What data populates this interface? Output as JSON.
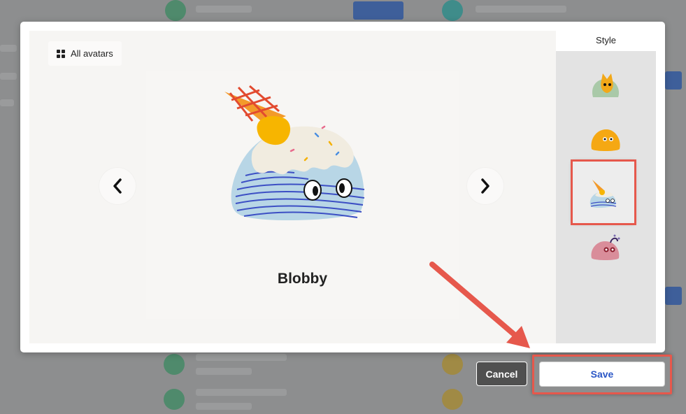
{
  "modal": {
    "all_avatars_label": "All avatars",
    "current_avatar": "Blobby",
    "style_title": "Style",
    "styles": [
      {
        "icon": "cat-blob-avatar-icon",
        "selected": false
      },
      {
        "icon": "yellow-blob-avatar-icon",
        "selected": false
      },
      {
        "icon": "icecream-blob-avatar-icon",
        "selected": true
      },
      {
        "icon": "pink-blob-avatar-icon",
        "selected": false
      }
    ]
  },
  "footer": {
    "cancel_label": "Cancel",
    "save_label": "Save"
  },
  "colors": {
    "highlight": "#e6584c",
    "save_text": "#2a56c6",
    "cancel_bg": "#505050"
  }
}
